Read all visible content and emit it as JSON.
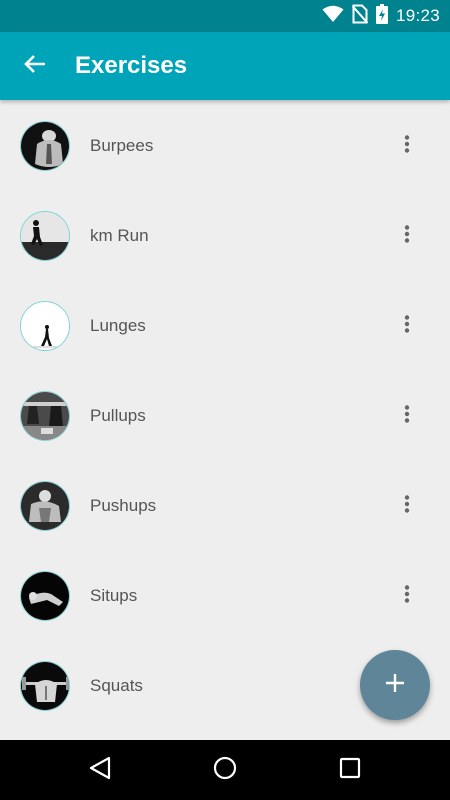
{
  "status_bar": {
    "time": "19:23",
    "icons": [
      "wifi-icon",
      "no-sim-icon",
      "battery-charging-icon"
    ],
    "background": "#00838f"
  },
  "app_bar": {
    "title": "Exercises",
    "back_icon": "arrow-back-icon",
    "background": "#00a4b8"
  },
  "exercises": [
    {
      "name": "Burpees",
      "thumbnail": "burpees-photo",
      "menu_icon": "more-vert-icon"
    },
    {
      "name": "km Run",
      "thumbnail": "run-photo",
      "menu_icon": "more-vert-icon"
    },
    {
      "name": "Lunges",
      "thumbnail": "lunges-photo",
      "menu_icon": "more-vert-icon"
    },
    {
      "name": "Pullups",
      "thumbnail": "pullups-photo",
      "menu_icon": "more-vert-icon"
    },
    {
      "name": "Pushups",
      "thumbnail": "pushups-photo",
      "menu_icon": "more-vert-icon"
    },
    {
      "name": "Situps",
      "thumbnail": "situps-photo",
      "menu_icon": "more-vert-icon"
    },
    {
      "name": "Squats",
      "thumbnail": "squats-photo",
      "menu_icon": "more-vert-icon"
    }
  ],
  "fab": {
    "icon": "add-icon",
    "color": "#5f8598"
  },
  "navigation_bar": {
    "buttons": [
      "back-triangle-icon",
      "home-circle-icon",
      "recents-square-icon"
    ]
  }
}
